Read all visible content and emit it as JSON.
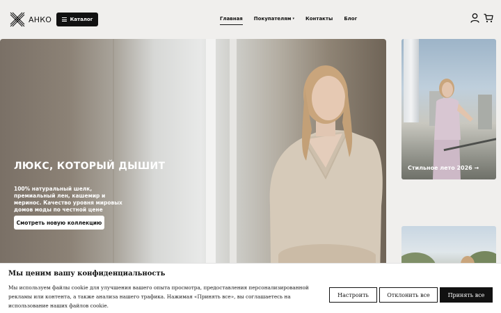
{
  "header": {
    "brand": "АНКО",
    "logo_icon": "crossed-lines-logo-icon",
    "catalog_label": "Каталог",
    "nav": [
      {
        "label": "Главная",
        "active": true
      },
      {
        "label": "Покупателям",
        "has_dropdown": true
      },
      {
        "label": "Контакты"
      },
      {
        "label": "Блог"
      }
    ],
    "icons": [
      "user-icon",
      "cart-icon"
    ]
  },
  "hero": {
    "title": "ЛЮКС, КОТОРЫЙ ДЫШИТ",
    "description": "100% натуральный шелк, премиальный лен, кашемир и меринос. Качество уровня мировых домов моды по честной цене",
    "button_label": "Смотреть новую коллекцию"
  },
  "side_cards": [
    {
      "label": "Стильное лето 2026",
      "arrow": "→"
    },
    {
      "label": ""
    }
  ],
  "cookie_banner": {
    "title": "Мы ценим вашу конфиденциальность",
    "text": "Мы используем файлы cookie для улучшения вашего опыта просмотра, предоставления персонализированной рекламы или контента, а также анализа нашего трафика. Нажимая «Принять все», вы соглашаетесь на использование наших файлов cookie.",
    "settings_label": "Настроить",
    "reject_label": "Отклонить все",
    "accept_label": "Принять все"
  },
  "colors": {
    "background": "#f0efed",
    "primary": "#111111",
    "white": "#ffffff"
  }
}
